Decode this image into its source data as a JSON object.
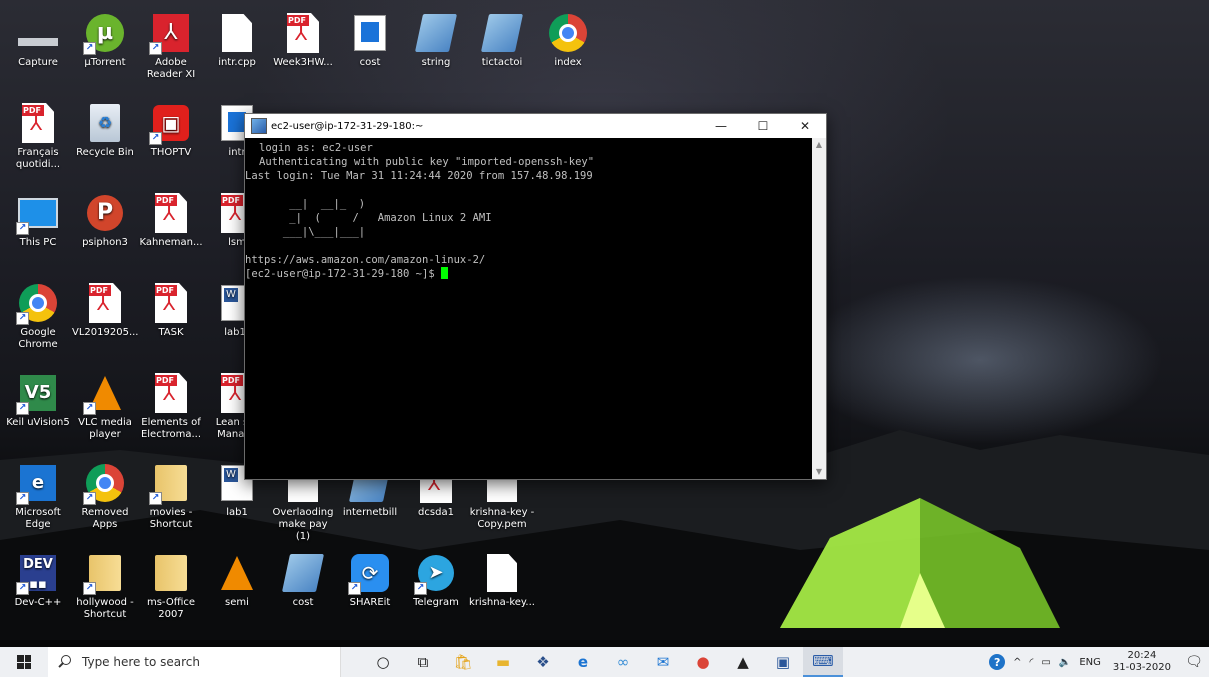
{
  "desktop_icons": [
    {
      "id": "capture",
      "label": "Capture",
      "icon": "capture-bar-icon"
    },
    {
      "id": "utorrent",
      "label": "µTorrent",
      "icon": "utorrent-icon"
    },
    {
      "id": "adobe",
      "label": "Adobe Reader XI",
      "icon": "adobe-reader-icon"
    },
    {
      "id": "intr",
      "label": "intr.cpp",
      "icon": "file-icon"
    },
    {
      "id": "week3",
      "label": "Week3HW...",
      "icon": "pdf-icon"
    },
    {
      "id": "cost1",
      "label": "cost",
      "icon": "document-icon"
    },
    {
      "id": "string",
      "label": "string",
      "icon": "notepad-icon"
    },
    {
      "id": "tictactoi",
      "label": "tictactoi",
      "icon": "notepad-icon"
    },
    {
      "id": "index",
      "label": "index",
      "icon": "chrome-icon"
    },
    {
      "id": "francais",
      "label": "Français quotidi...",
      "icon": "pdf-icon"
    },
    {
      "id": "recycle",
      "label": "Recycle Bin",
      "icon": "recycle-bin-icon"
    },
    {
      "id": "thoptv",
      "label": "THOPTV",
      "icon": "thoptv-icon"
    },
    {
      "id": "intr2",
      "label": "intr",
      "icon": "document-icon"
    },
    {
      "id": "thispc",
      "label": "This PC",
      "icon": "this-pc-icon"
    },
    {
      "id": "psiphon",
      "label": "psiphon3",
      "icon": "psiphon-icon"
    },
    {
      "id": "kahneman",
      "label": "Kahneman...",
      "icon": "pdf-icon"
    },
    {
      "id": "lsm",
      "label": "lsm",
      "icon": "pdf-icon"
    },
    {
      "id": "gchrome",
      "label": "Google Chrome",
      "icon": "chrome-icon"
    },
    {
      "id": "vl2019",
      "label": "VL2019205...",
      "icon": "pdf-icon"
    },
    {
      "id": "task",
      "label": "TASK",
      "icon": "pdf-icon"
    },
    {
      "id": "lab1b",
      "label": "lab1[",
      "icon": "word-icon"
    },
    {
      "id": "keil",
      "label": "Keil uVision5",
      "icon": "keil-icon"
    },
    {
      "id": "vlc",
      "label": "VLC media player",
      "icon": "vlc-icon"
    },
    {
      "id": "elements",
      "label": "Elements of Electroma...",
      "icon": "pdf-icon"
    },
    {
      "id": "lean",
      "label": "Lean sta Manage",
      "icon": "pdf-icon"
    },
    {
      "id": "edge",
      "label": "Microsoft Edge",
      "icon": "edge-icon"
    },
    {
      "id": "removed",
      "label": "Removed Apps",
      "icon": "chrome-icon"
    },
    {
      "id": "movies",
      "label": "movies - Shortcut",
      "icon": "folder-icon"
    },
    {
      "id": "lab1",
      "label": "lab1",
      "icon": "word-icon"
    },
    {
      "id": "overlaoding",
      "label": "Overlaoding make pay (1)",
      "icon": "file-icon"
    },
    {
      "id": "internetbill",
      "label": "internetbill",
      "icon": "notepad-icon"
    },
    {
      "id": "dcsda1",
      "label": "dcsda1",
      "icon": "pdf-icon"
    },
    {
      "id": "krishnacopy",
      "label": "krishna-key - Copy.pem",
      "icon": "file-icon"
    },
    {
      "id": "devcpp",
      "label": "Dev-C++",
      "icon": "devcpp-icon"
    },
    {
      "id": "hollywood",
      "label": "hollywood - Shortcut",
      "icon": "folder-icon"
    },
    {
      "id": "msoffice",
      "label": "ms-Office 2007",
      "icon": "folder-icon"
    },
    {
      "id": "semi",
      "label": "semi",
      "icon": "vlc-icon"
    },
    {
      "id": "cost2",
      "label": "cost",
      "icon": "notepad-icon"
    },
    {
      "id": "shareit",
      "label": "SHAREit",
      "icon": "shareit-icon"
    },
    {
      "id": "telegram",
      "label": "Telegram",
      "icon": "telegram-icon"
    },
    {
      "id": "krishnakey",
      "label": "krishna-key...",
      "icon": "file-icon"
    }
  ],
  "terminal": {
    "title": "ec2-user@ip-172-31-29-180:~",
    "lines": [
      "login as: ec2-user",
      "Authenticating with public key \"imported-openssh-key\"",
      "Last login: Tue Mar 31 11:24:44 2020 from 157.48.98.199",
      "",
      "       __|  __|_  )",
      "       _|  (     /   Amazon Linux 2 AMI",
      "      ___|\\___|___|",
      "",
      "https://aws.amazon.com/amazon-linux-2/"
    ],
    "prompt": "[ec2-user@ip-172-31-29-180 ~]$ ",
    "controls": {
      "minimize": "—",
      "maximize": "☐",
      "close": "✕"
    }
  },
  "taskbar": {
    "search_placeholder": "Type here to search",
    "apps": [
      "cortana-icon",
      "task-view-icon",
      "store-icon",
      "file-explorer-icon",
      "dropbox-icon",
      "edge-icon",
      "infinity-icon",
      "mail-icon",
      "chrome-icon",
      "photos-icon",
      "word-icon",
      "putty-icon"
    ],
    "tray": {
      "language": "ENG",
      "time": "20:24",
      "date": "31-03-2020"
    }
  }
}
